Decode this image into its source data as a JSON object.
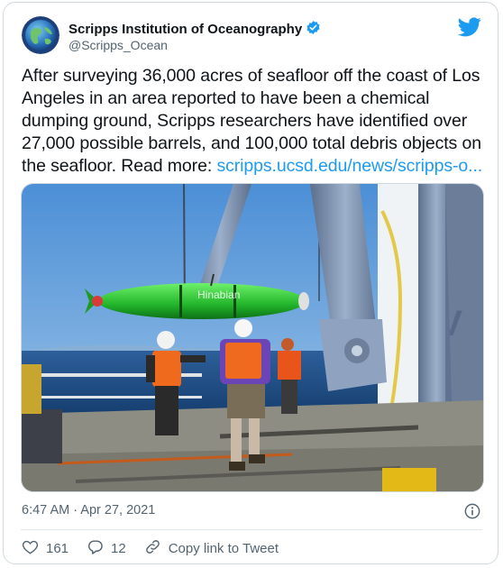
{
  "account": {
    "name": "Scripps Institution of Oceanography",
    "handle": "@Scripps_Ocean",
    "verified": true
  },
  "tweet": {
    "text_main": "After surveying 36,000 acres of seafloor off the coast of Los Angeles in an area reported to have been a chemical dumping ground, Scripps researchers have identified over 27,000 possible barrels, and 100,000 total debris objects on the seafloor. Read more: ",
    "link_text": "scripps.ucsd.edu/news/scripps-o...",
    "timestamp": "6:47 AM · Apr 27, 2021",
    "photo_watermark": "Hinabian"
  },
  "actions": {
    "likes": "161",
    "replies": "12",
    "copy_link_label": "Copy link to Tweet"
  },
  "colors": {
    "accent": "#1d9bf0",
    "text": "#0f1419",
    "muted": "#536471",
    "like": "#1d9bf0"
  },
  "icons": [
    "globe-logo",
    "verified-badge-icon",
    "twitter-bird-icon",
    "info-icon",
    "heart-icon",
    "reply-icon",
    "link-icon"
  ]
}
